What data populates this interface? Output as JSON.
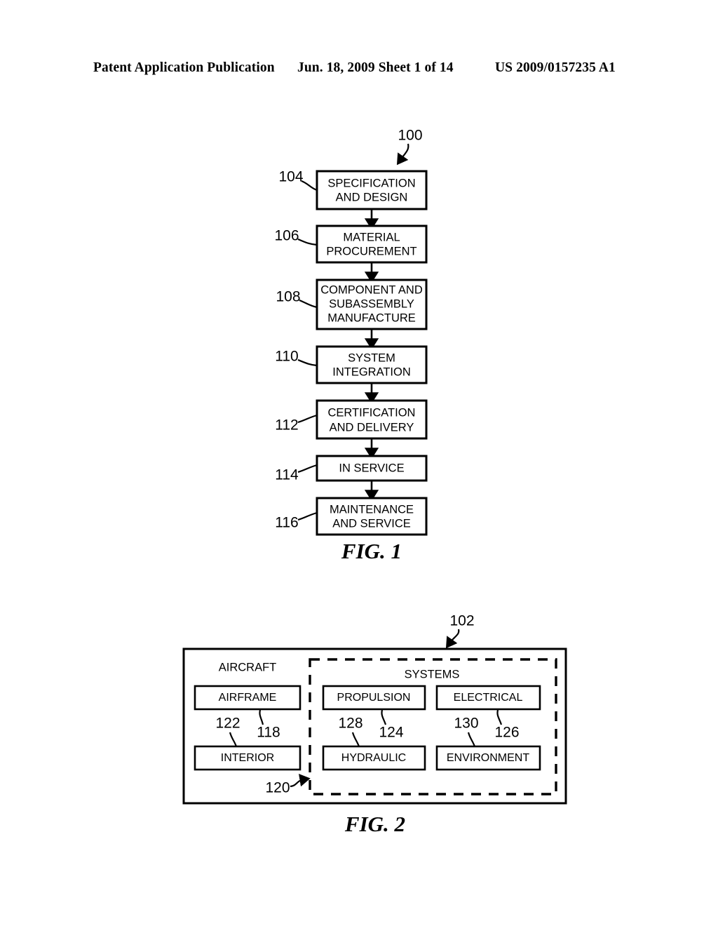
{
  "header": {
    "left": "Patent Application Publication",
    "middle": "Jun. 18, 2009  Sheet 1 of 14",
    "right": "US 2009/0157235 A1"
  },
  "figure1": {
    "caption": "FIG. 1",
    "diagram_ref": "100",
    "steps": [
      {
        "ref": "104",
        "lines": [
          "SPECIFICATION",
          "AND DESIGN"
        ]
      },
      {
        "ref": "106",
        "lines": [
          "MATERIAL",
          "PROCUREMENT"
        ]
      },
      {
        "ref": "108",
        "lines": [
          "COMPONENT AND",
          "SUBASSEMBLY",
          "MANUFACTURE"
        ]
      },
      {
        "ref": "110",
        "lines": [
          "SYSTEM",
          "INTEGRATION"
        ]
      },
      {
        "ref": "112",
        "lines": [
          "CERTIFICATION",
          "AND DELIVERY"
        ]
      },
      {
        "ref": "114",
        "lines": [
          "IN SERVICE"
        ]
      },
      {
        "ref": "116",
        "lines": [
          "MAINTENANCE",
          "AND SERVICE"
        ]
      }
    ]
  },
  "figure2": {
    "caption": "FIG. 2",
    "diagram_ref": "102",
    "aircraft_label": "AIRCRAFT",
    "systems_label": "SYSTEMS",
    "systems_group_ref": "120",
    "aircraft_blocks": [
      {
        "ref": "118",
        "label": "AIRFRAME"
      },
      {
        "ref": "122",
        "label": "INTERIOR"
      }
    ],
    "systems_blocks": [
      {
        "ref": "124",
        "label": "PROPULSION"
      },
      {
        "ref": "126",
        "label": "ELECTRICAL"
      },
      {
        "ref": "128",
        "label": "HYDRAULIC"
      },
      {
        "ref": "130",
        "label": "ENVIRONMENT"
      }
    ]
  }
}
